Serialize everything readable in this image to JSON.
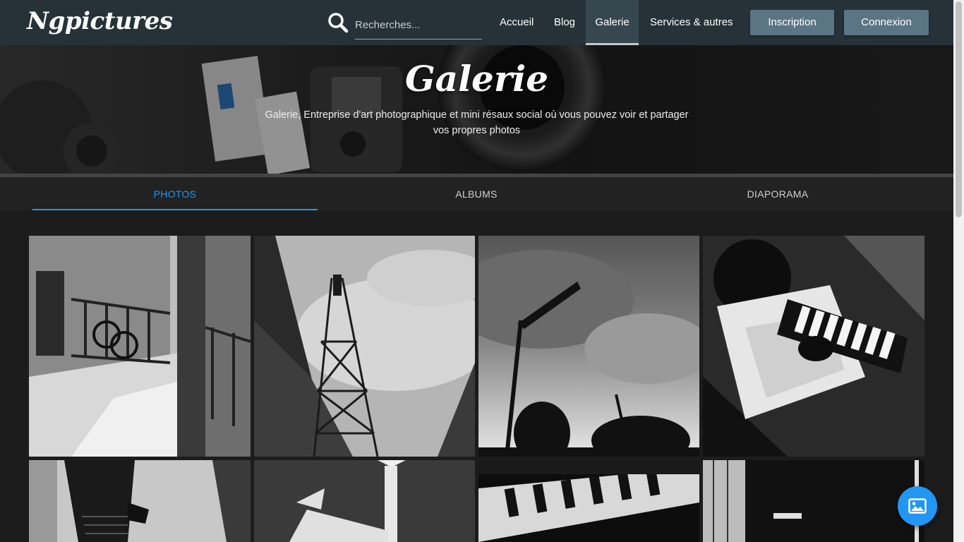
{
  "navbar": {
    "logo": "Ngpictures",
    "search_placeholder": "Recherches...",
    "items": [
      {
        "label": "Accueil"
      },
      {
        "label": "Blog"
      },
      {
        "label": "Galerie"
      },
      {
        "label": "Services & autres"
      }
    ],
    "signup_label": "Inscription",
    "login_label": "Connexion"
  },
  "hero": {
    "title": "Galerie",
    "subtitle": "Galerie, Entreprise d'art photographique et mini résaux social où vous pouvez voir et partager vos propres photos"
  },
  "tabs": [
    {
      "label": "PHOTOS"
    },
    {
      "label": "ALBUMS"
    },
    {
      "label": "DIAPORAMA"
    }
  ],
  "colors": {
    "navbar": "#263238",
    "accent": "#2196f3",
    "button": "#5b7584"
  },
  "gallery": {
    "photos": [
      {
        "icon": "photo-bicycle-corridor"
      },
      {
        "icon": "photo-telecom-tower"
      },
      {
        "icon": "photo-street-lamp-sky"
      },
      {
        "icon": "photo-keyboard-player"
      },
      {
        "icon": "photo-legs-walking"
      },
      {
        "icon": "photo-road-arrow"
      },
      {
        "icon": "photo-piano-keys"
      },
      {
        "icon": "photo-hallway"
      }
    ]
  },
  "fab": {
    "icon": "image-icon"
  }
}
